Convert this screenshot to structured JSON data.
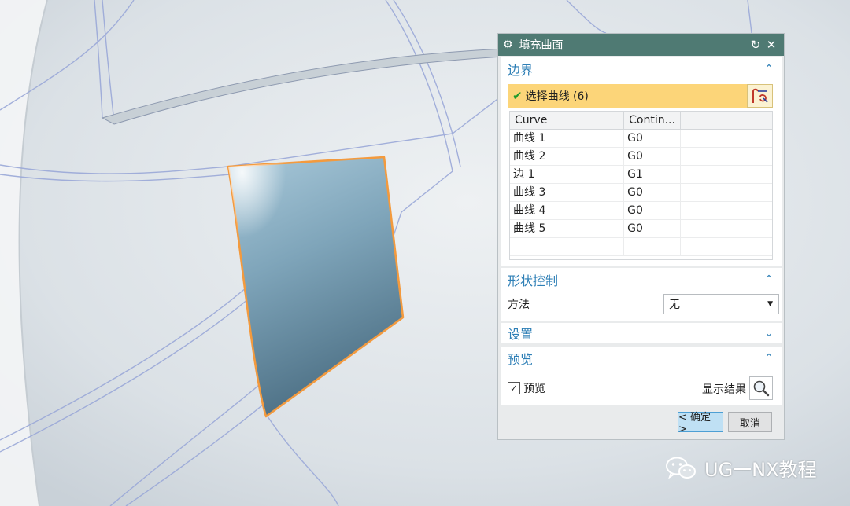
{
  "dialog": {
    "title": "填充曲面",
    "icons": {
      "gear": "gear-icon",
      "reset": "reset-icon",
      "close": "close-icon"
    }
  },
  "boundary": {
    "heading": "边界",
    "select_label": "选择曲线 (6)",
    "columns": [
      "Curve",
      "Contin..."
    ],
    "rows": [
      {
        "curve": "曲线 1",
        "cont": "G0"
      },
      {
        "curve": "曲线 2",
        "cont": "G0"
      },
      {
        "curve": "边 1",
        "cont": "G1"
      },
      {
        "curve": "曲线 3",
        "cont": "G0"
      },
      {
        "curve": "曲线 4",
        "cont": "G0"
      },
      {
        "curve": "曲线 5",
        "cont": "G0"
      }
    ]
  },
  "shape_control": {
    "heading": "形状控制",
    "method_label": "方法",
    "method_value": "无"
  },
  "settings": {
    "heading": "设置"
  },
  "preview": {
    "heading": "预览",
    "preview_label": "预览",
    "preview_checked": true,
    "show_result_label": "显示结果"
  },
  "buttons": {
    "ok": "< 确定 >",
    "cancel": "取消"
  },
  "watermark": {
    "text": "UG一NX教程"
  },
  "colors": {
    "titlebar": "#4f7a73",
    "accent": "#2e7fb6",
    "selection": "#fcd579",
    "surface_edge": "#f39a3e"
  }
}
